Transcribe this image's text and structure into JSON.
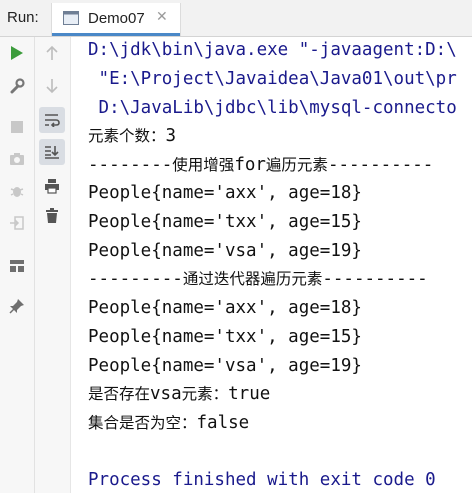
{
  "header": {
    "run_label": "Run:",
    "tab_title": "Demo07",
    "tab_close": "✕"
  },
  "toolbar_left": [
    {
      "name": "rerun-icon",
      "color": "#3c9c3c"
    },
    {
      "name": "wrench-icon",
      "color": "#7a7a7a"
    },
    {
      "name": "stop-icon",
      "color": "#c6c6c6"
    },
    {
      "name": "camera-icon",
      "color": "#c6c6c6"
    },
    {
      "name": "bug-icon",
      "color": "#c6c6c6"
    },
    {
      "name": "login-icon",
      "color": "#c6c6c6"
    },
    {
      "name": "layout-icon",
      "color": "#6f6f6f"
    },
    {
      "name": "pin-icon",
      "color": "#6f6f6f"
    }
  ],
  "toolbar_right": [
    {
      "name": "up-arrow-icon"
    },
    {
      "name": "down-arrow-icon"
    },
    {
      "name": "soft-wrap-icon"
    },
    {
      "name": "scroll-to-end-icon"
    },
    {
      "name": "print-icon"
    },
    {
      "name": "trash-icon"
    }
  ],
  "console": {
    "cmd_line1": "D:\\jdk\\bin\\java.exe \"-javaagent:D:\\",
    "cmd_line2": " \"E:\\Project\\Javaidea\\Java01\\out\\pr",
    "cmd_line3": " D:\\JavaLib\\jdbc\\lib\\mysql-connecto",
    "count_label": "元素个数：",
    "count_value": "3",
    "sep1_left": "--------",
    "sep1_mid1": "使用增强",
    "sep1_mid2": "for",
    "sep1_mid3": "遍历元素",
    "sep1_right": "----------",
    "people1": "People{name='axx', age=18}",
    "people2": "People{name='txx', age=15}",
    "people3": "People{name='vsa', age=19}",
    "sep2_left": "---------",
    "sep2_mid": "通过迭代器遍历元素",
    "sep2_right": "----------",
    "people4": "People{name='axx', age=18}",
    "people5": "People{name='txx', age=15}",
    "people6": "People{name='vsa', age=19}",
    "exists_label1": "是否存在",
    "exists_label2": "vsa",
    "exists_label3": "元素：",
    "exists_value": "true",
    "empty_label": "集合是否为空：",
    "empty_value": "false",
    "exit_line": "Process finished with exit code 0"
  }
}
